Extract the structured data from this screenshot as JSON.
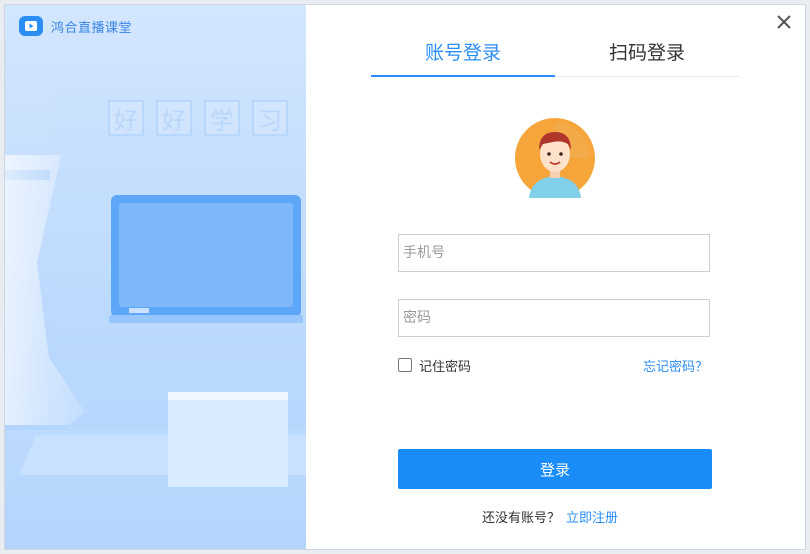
{
  "app": {
    "title": "鸿合直播课堂"
  },
  "illustration": {
    "characters": [
      "好",
      "好",
      "学",
      "习"
    ]
  },
  "tabs": [
    {
      "label": "账号登录",
      "active": true
    },
    {
      "label": "扫码登录",
      "active": false
    }
  ],
  "form": {
    "phone_placeholder": "手机号",
    "password_placeholder": "密码",
    "remember_label": "记住密码",
    "remember_checked": false,
    "forgot_label": "忘记密码？",
    "login_label": "登录",
    "no_account_text": "还没有账号？",
    "register_label": "立即注册"
  },
  "icons": {
    "close": "close-icon",
    "logo": "tv-play-icon",
    "avatar": "user-avatar"
  },
  "colors": {
    "accent": "#2b8ef5",
    "button": "#1a8cf7",
    "panel": "#c1dcfe"
  }
}
